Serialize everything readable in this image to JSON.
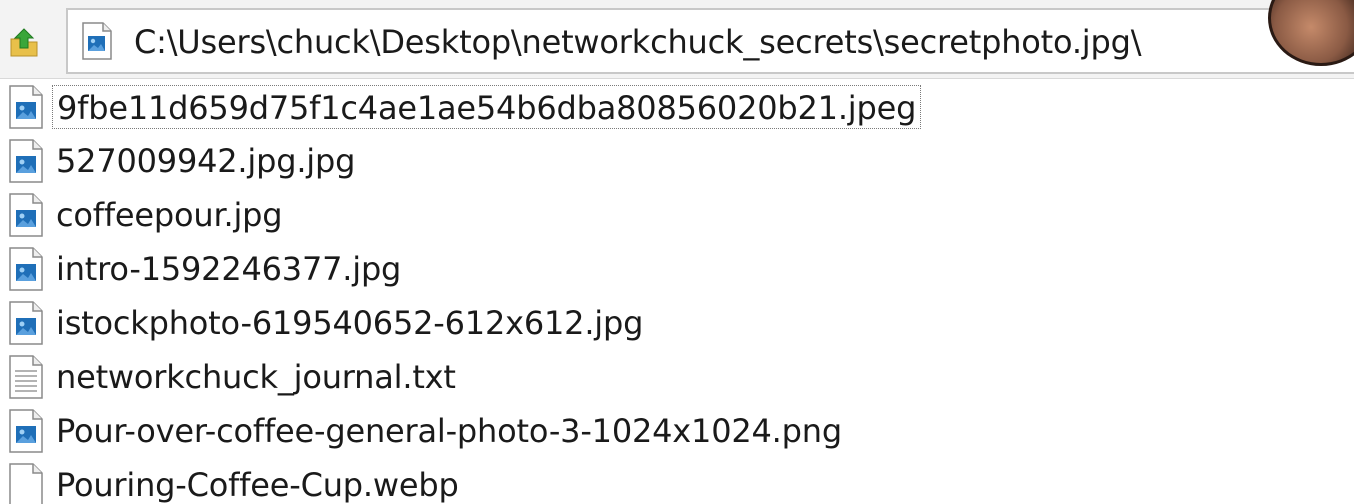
{
  "address_bar": {
    "path": "C:\\Users\\chuck\\Desktop\\networkchuck_secrets\\secretphoto.jpg\\",
    "icon": "image-file-icon"
  },
  "toolbar": {
    "up_icon": "up-folder-arrow-icon"
  },
  "files": [
    {
      "name": "9fbe11d659d75f1c4ae1ae54b6dba80856020b21.jpeg",
      "icon": "image-file-icon",
      "focused": true
    },
    {
      "name": "527009942.jpg.jpg",
      "icon": "image-file-icon"
    },
    {
      "name": "coffeepour.jpg",
      "icon": "image-file-icon"
    },
    {
      "name": "intro-1592246377.jpg",
      "icon": "image-file-icon"
    },
    {
      "name": "istockphoto-619540652-612x612.jpg",
      "icon": "image-file-icon"
    },
    {
      "name": "networkchuck_journal.txt",
      "icon": "text-file-icon"
    },
    {
      "name": "Pour-over-coffee-general-photo-3-1024x1024.png",
      "icon": "image-file-icon"
    },
    {
      "name": "Pouring-Coffee-Cup.webp",
      "icon": "blank-file-icon"
    }
  ],
  "colors": {
    "icon_blue": "#1f6fb8",
    "text": "#1a1a1a",
    "up_arrow_green": "#3aa63a",
    "folder_yellow": "#e8c04a"
  }
}
